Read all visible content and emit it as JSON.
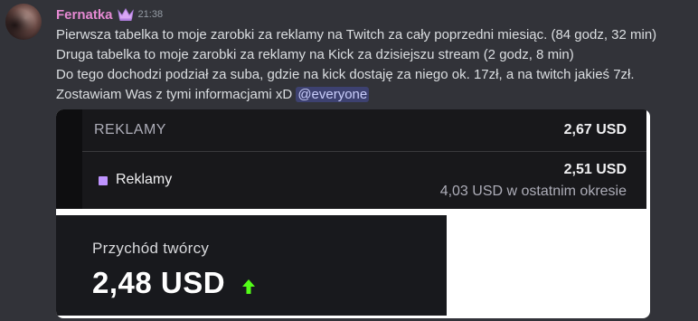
{
  "message": {
    "username": "Fernatka",
    "timestamp": "21:38",
    "lines": [
      "Pierwsza tabelka to moje zarobki za reklamy na Twitch za cały poprzedni miesiąc. (84 godz, 32 min)",
      "Druga tabelka to moje zarobki za reklamy na Kick za dzisiejszu stream (2 godz, 8 min)",
      "Do tego dochodzi podział za suba, gdzie na kick dostaję za niego ok. 17zł, a na twitch jakieś 7zł."
    ],
    "last_line_text": "Zostawiam Was z tymi informacjami xD ",
    "mention": "@everyone",
    "colors": {
      "username": "#e589d2",
      "mention_bg": "#5865f2"
    },
    "badge_icon": "crown-icon"
  },
  "twitch_table": {
    "header_label": "REKLAMY",
    "header_value": "2,67 USD",
    "item_label": "Reklamy",
    "item_value": "2,51 USD",
    "item_sub": "4,03 USD w ostatnim okresie",
    "swatch_color": "#bf94ff"
  },
  "kick_card": {
    "label": "Przychód twórcy",
    "amount": "2,48 USD",
    "trend_icon": "arrow-up-icon",
    "trend_color": "#53fc18"
  }
}
